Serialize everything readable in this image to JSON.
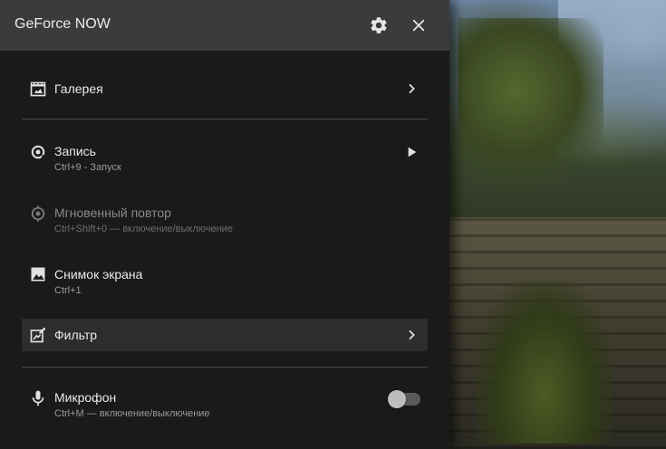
{
  "header": {
    "title": "GeForce NOW",
    "settings_icon": "gear-icon",
    "close_icon": "close-icon"
  },
  "menu": {
    "gallery": {
      "label": "Галерея",
      "icon": "gallery-icon"
    },
    "record": {
      "label": "Запись",
      "sub": "Ctrl+9 - Запуск",
      "icon": "record-icon"
    },
    "instant_replay": {
      "label": "Мгновенный повтор",
      "sub": "Ctrl+Shift+0 — включение/выключение",
      "icon": "instant-replay-icon"
    },
    "screenshot": {
      "label": "Снимок экрана",
      "sub": "Ctrl+1",
      "icon": "image-icon"
    },
    "filter": {
      "label": "Фильтр",
      "icon": "filter-icon"
    },
    "microphone": {
      "label": "Микрофон",
      "sub": "Ctrl+M — включение/выключение",
      "icon": "microphone-icon",
      "enabled": false
    }
  },
  "colors": {
    "panel": "#1a1a1a",
    "header": "#3b3b3b",
    "active_row": "#2d2d2d"
  }
}
